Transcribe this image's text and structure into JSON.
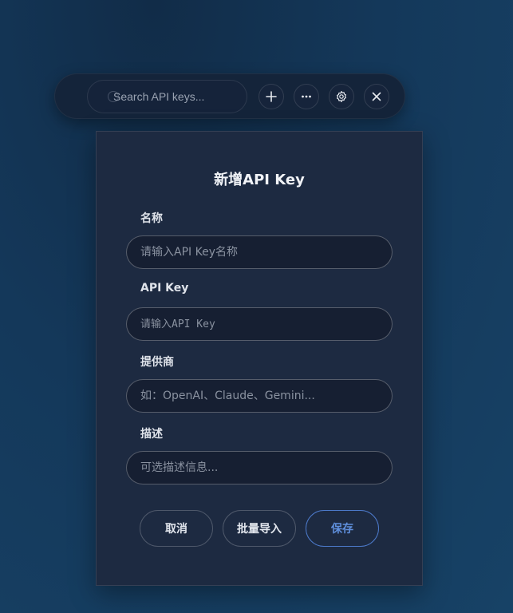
{
  "toolbar": {
    "search_placeholder": "Search API keys...",
    "buttons": [
      {
        "icon": "plus-icon"
      },
      {
        "icon": "more-icon"
      },
      {
        "icon": "gear-icon"
      },
      {
        "icon": "close-icon"
      }
    ]
  },
  "dialog": {
    "title": "新增API Key",
    "fields": {
      "name": {
        "label": "名称",
        "placeholder": "请输入API Key名称",
        "value": ""
      },
      "key": {
        "label": "API Key",
        "placeholder": "请输入API Key",
        "value": ""
      },
      "provider": {
        "label": "提供商",
        "placeholder": "如：OpenAI、Claude、Gemini...",
        "value": ""
      },
      "description": {
        "label": "描述",
        "placeholder": "可选描述信息...",
        "value": ""
      }
    },
    "buttons": {
      "cancel": "取消",
      "bulk_import": "批量导入",
      "save": "保存"
    }
  },
  "colors": {
    "accent": "#4c79c9",
    "panel": "#1d2a41",
    "toolbar": "#14243a"
  }
}
